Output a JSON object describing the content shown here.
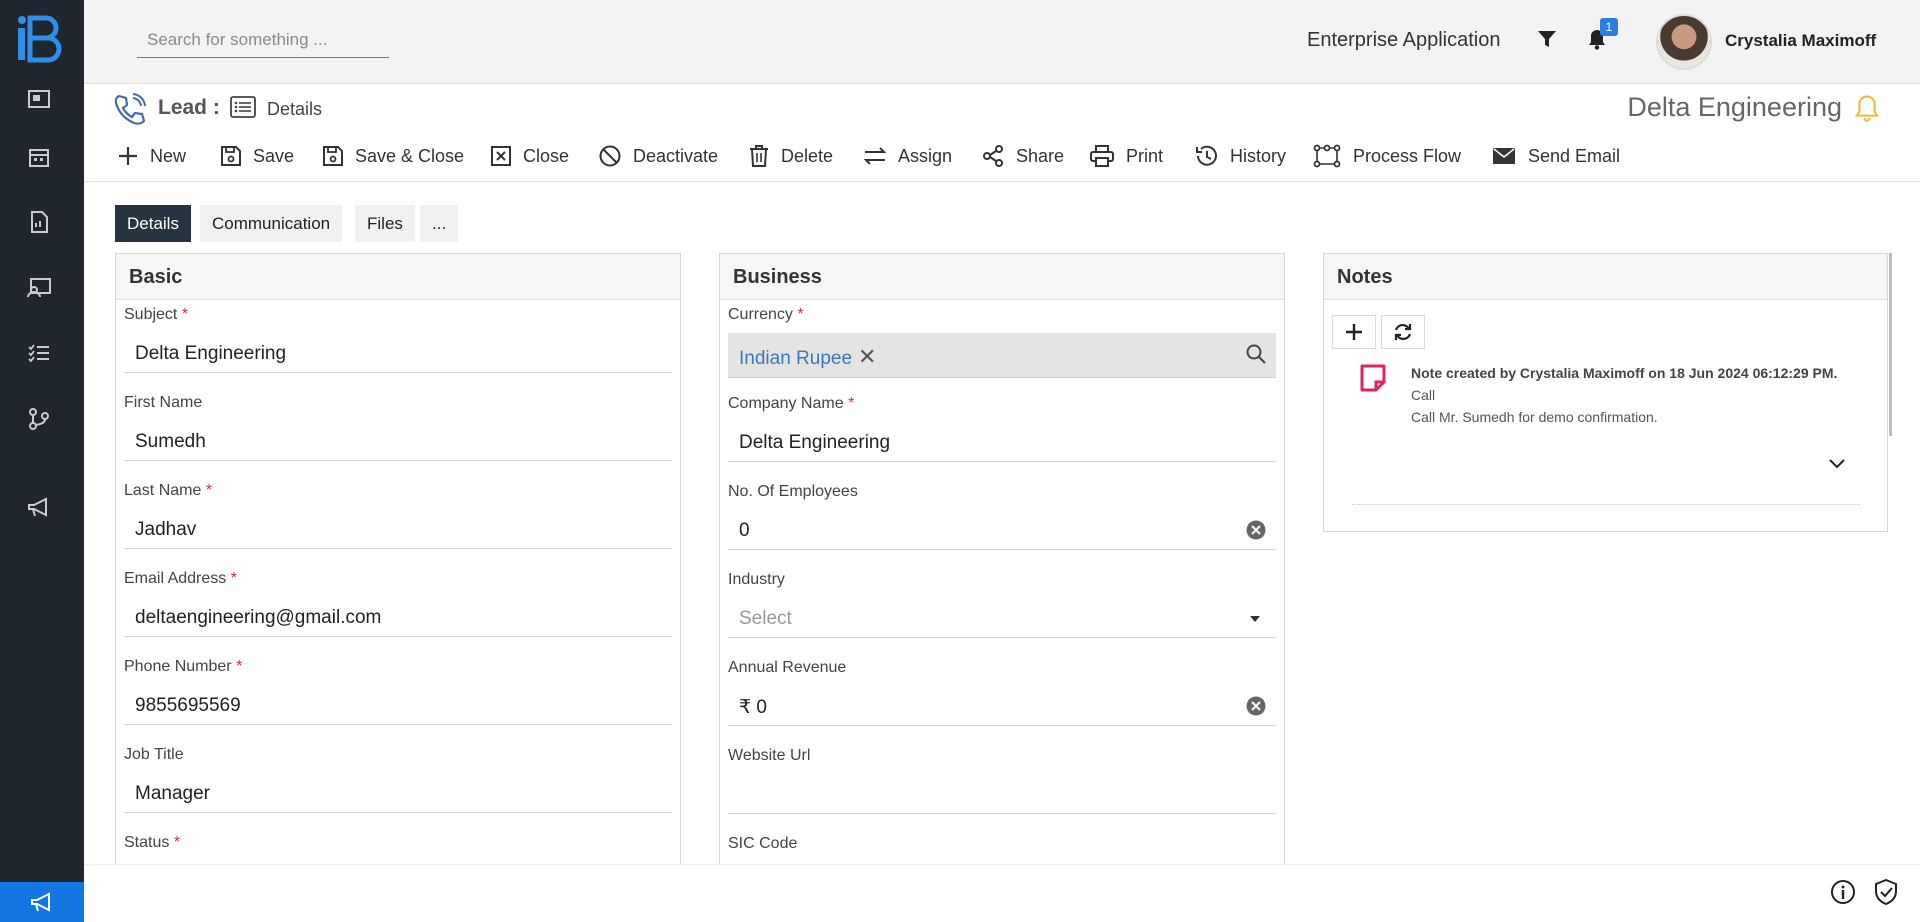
{
  "header": {
    "search_placeholder": "Search for something ...",
    "app_name": "Enterprise Application",
    "notification_count": "1",
    "user_name": "Crystalia Maximoff"
  },
  "title_bar": {
    "entity": "Lead :",
    "view": "Details",
    "record_name": "Delta Engineering"
  },
  "toolbar": {
    "new": "New",
    "save": "Save",
    "save_close": "Save & Close",
    "close": "Close",
    "deactivate": "Deactivate",
    "delete": "Delete",
    "assign": "Assign",
    "share": "Share",
    "print": "Print",
    "history": "History",
    "process_flow": "Process Flow",
    "send_email": "Send Email"
  },
  "tabs": [
    "Details",
    "Communication",
    "Files",
    "..."
  ],
  "basic": {
    "title": "Basic",
    "subject_label": "Subject",
    "subject": "Delta Engineering",
    "first_name_label": "First Name",
    "first_name": "Sumedh",
    "last_name_label": "Last Name",
    "last_name": "Jadhav",
    "email_label": "Email Address",
    "email": "deltaengineering@gmail.com",
    "phone_label": "Phone Number",
    "phone": "9855695569",
    "job_title_label": "Job Title",
    "job_title": "Manager",
    "status_label": "Status"
  },
  "business": {
    "title": "Business",
    "currency_label": "Currency",
    "currency": "Indian Rupee",
    "company_label": "Company Name",
    "company": "Delta Engineering",
    "employees_label": "No. Of Employees",
    "employees": "0",
    "industry_label": "Industry",
    "industry_placeholder": "Select",
    "revenue_label": "Annual Revenue",
    "revenue": "₹ 0",
    "website_label": "Website Url",
    "website": "",
    "sic_label": "SIC Code"
  },
  "notes": {
    "title": "Notes",
    "items": [
      {
        "header": "Note created by Crystalia Maximoff on 18 Jun 2024 06:12:29 PM.",
        "subject": "Call",
        "body": "Call Mr. Sumedh for demo confirmation."
      }
    ]
  },
  "colors": {
    "sidebar": "#1f262e",
    "active_tab": "#263340",
    "accent_blue": "#2a7de1",
    "required": "#d0312d",
    "note_icon": "#e0245e",
    "bell_accent": "#f5b83d"
  }
}
